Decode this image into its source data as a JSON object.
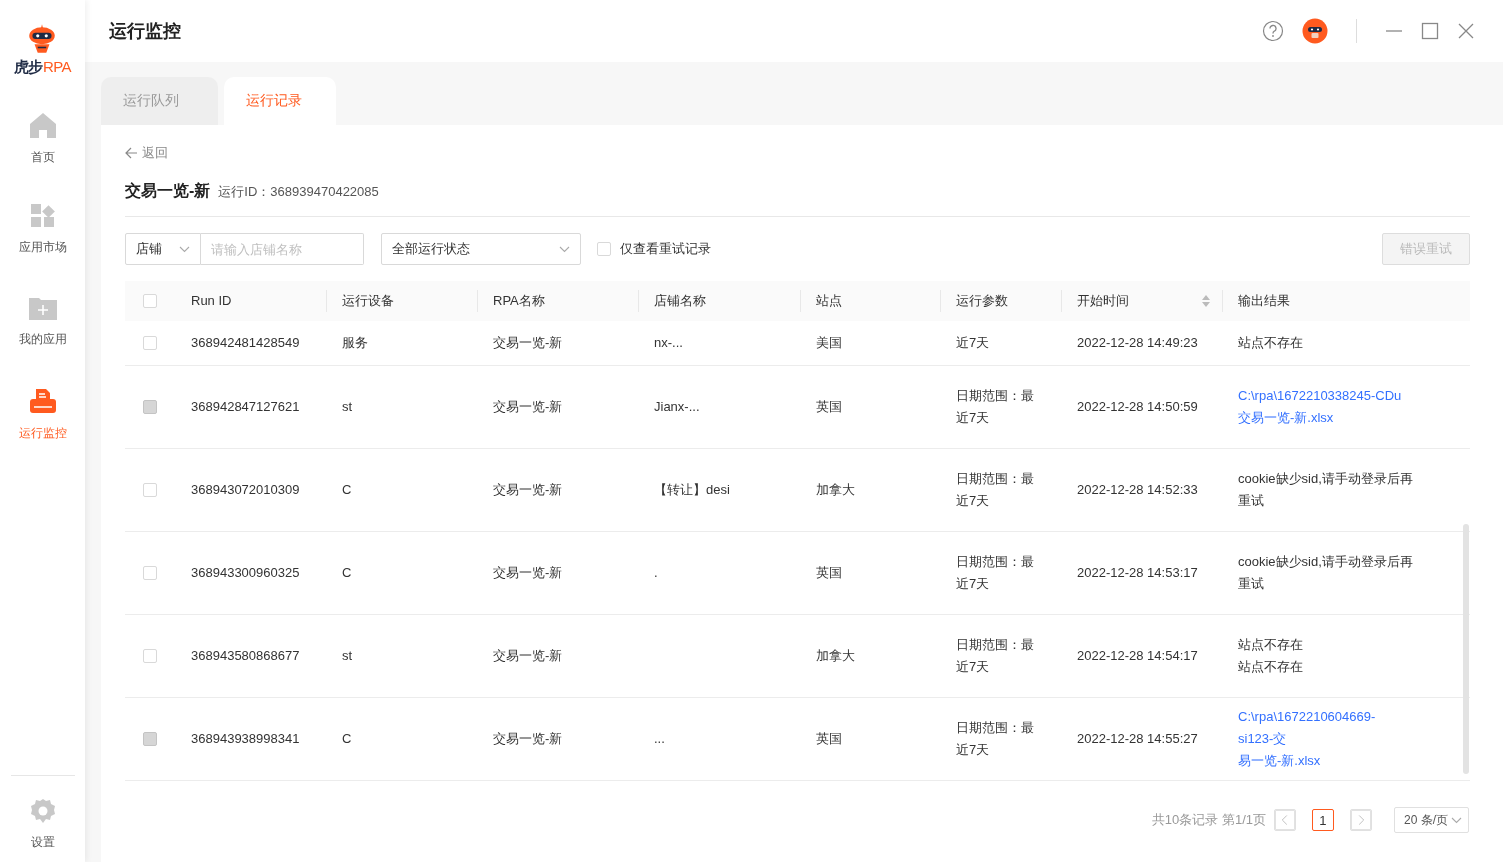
{
  "logo": {
    "brand": "虎步",
    "suffix": "RPA"
  },
  "sidebar": {
    "items": [
      {
        "label": "首页",
        "selected": false
      },
      {
        "label": "应用市场",
        "selected": false
      },
      {
        "label": "我的应用",
        "selected": false
      },
      {
        "label": "运行监控",
        "selected": true
      }
    ],
    "settings": {
      "label": "设置"
    }
  },
  "window": {
    "title": "运行监控"
  },
  "tabs": [
    {
      "label": "运行队列",
      "selected": false
    },
    {
      "label": "运行记录",
      "selected": true
    }
  ],
  "back": {
    "label": "返回"
  },
  "record": {
    "name": "交易一览-新",
    "run_id": "运行ID：368939470422085"
  },
  "filters": {
    "store_select": "店铺",
    "store_search": {
      "placeholder": "请输入店铺名称"
    },
    "status_select": "全部运行状态",
    "retry_only": {
      "label": "仅查看重试记录",
      "checked": false
    },
    "retry_button": {
      "label": "错误重试",
      "disabled": true
    }
  },
  "table": {
    "columns": [
      "Run ID",
      "运行设备",
      "RPA名称",
      "店铺名称",
      "站点",
      "运行参数",
      "开始时间",
      "输出结果"
    ],
    "select_all": {
      "checked": false
    },
    "rows": [
      {
        "checked": false,
        "disabled": false,
        "run_id": "368942481428549",
        "device": "服务",
        "rpa": "交易一览-新",
        "store": "nx-...",
        "site": "美国",
        "params": [
          "近7天"
        ],
        "time": "2022-12-28 14:49:23",
        "output": {
          "kind": "text",
          "lines": [
            "站点不存在"
          ]
        }
      },
      {
        "checked": false,
        "disabled": true,
        "run_id": "368942847127621",
        "device": "st",
        "rpa": "交易一览-新",
        "store": "Jianx-...",
        "site": "英国",
        "params": [
          "日期范围：最",
          "近7天"
        ],
        "time": "2022-12-28 14:50:59",
        "output": {
          "kind": "link",
          "lines": [
            "C:\\rpa\\1672210338245-CDu",
            "交易一览-新.xlsx"
          ]
        }
      },
      {
        "checked": false,
        "disabled": false,
        "run_id": "368943072010309",
        "device": "C",
        "rpa": "交易一览-新",
        "store": "【转让】desi",
        "site": "加拿大",
        "params": [
          "日期范围：最",
          "近7天"
        ],
        "time": "2022-12-28 14:52:33",
        "output": {
          "kind": "text",
          "lines": [
            "cookie缺少sid,请手动登录后再",
            "重试"
          ]
        }
      },
      {
        "checked": false,
        "disabled": false,
        "run_id": "368943300960325",
        "device": "C",
        "rpa": "交易一览-新",
        "store": ".",
        "site": "英国",
        "params": [
          "日期范围：最",
          "近7天"
        ],
        "time": "2022-12-28 14:53:17",
        "output": {
          "kind": "text",
          "lines": [
            "cookie缺少sid,请手动登录后再",
            "重试"
          ]
        }
      },
      {
        "checked": false,
        "disabled": false,
        "run_id": "368943580868677",
        "device": "st",
        "rpa": "交易一览-新",
        "site": "加拿大",
        "params": [
          "日期范围：最",
          "近7天"
        ],
        "time": "2022-12-28 14:54:17",
        "output": {
          "kind": "text",
          "lines": [
            "站点不存在",
            "站点不存在"
          ]
        }
      },
      {
        "checked": false,
        "disabled": true,
        "run_id": "368943938998341",
        "device": "C",
        "rpa": "交易一览-新",
        "store": "...",
        "site": "英国",
        "params": [
          "日期范围：最",
          "近7天"
        ],
        "time": "2022-12-28 14:55:27",
        "output": {
          "kind": "link",
          "lines": [
            "C:\\rpa\\1672210604669-",
            "si123-交",
            "易一览-新.xlsx"
          ]
        }
      }
    ]
  },
  "pagination": {
    "summary": "共10条记录 第1/1页",
    "pages": [
      {
        "label": "1",
        "selected": true
      }
    ],
    "page_size": "20 条/页"
  }
}
